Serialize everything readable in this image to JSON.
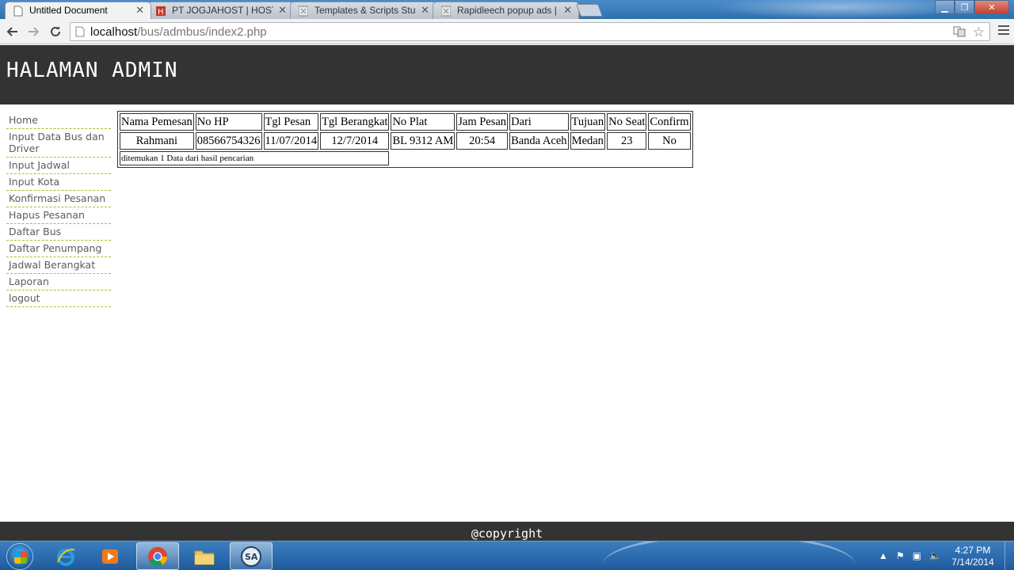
{
  "browser": {
    "tabs": [
      {
        "title": "Untitled Document",
        "active": true
      },
      {
        "title": "PT JOGJAHOST | HOSTING",
        "active": false
      },
      {
        "title": "Templates & Scripts Stuff",
        "active": false
      },
      {
        "title": "Rapidleech popup ads | Ka",
        "active": false
      }
    ],
    "url_host": "localhost",
    "url_path": "/bus/admbus/index2.php"
  },
  "header": {
    "title": "HALAMAN ADMIN"
  },
  "sidebar": {
    "items": [
      {
        "label": "Home"
      },
      {
        "label": "Input Data Bus dan Driver"
      },
      {
        "label": "Input Jadwal"
      },
      {
        "label": "Input Kota"
      },
      {
        "label": "Konfirmasi Pesanan"
      },
      {
        "label": "Hapus Pesanan"
      },
      {
        "label": "Daftar Bus"
      },
      {
        "label": "Daftar Penumpang"
      },
      {
        "label": "Jadwal Berangkat"
      },
      {
        "label": "Laporan"
      },
      {
        "label": "logout"
      }
    ]
  },
  "table": {
    "columns": [
      "Nama Pemesan",
      "No HP",
      "Tgl Pesan",
      "Tgl Berangkat",
      "No Plat",
      "Jam Pesan",
      "Dari",
      "Tujuan",
      "No Seat",
      "Confirm"
    ],
    "rows": [
      [
        "Rahmani",
        "08566754326",
        "11/07/2014",
        "12/7/2014",
        "BL 9312 AM",
        "20:54",
        "Banda Aceh",
        "Medan",
        "23",
        "No"
      ]
    ],
    "footer_text": "ditemukan 1 Data dari hasil pencarian"
  },
  "footer": {
    "text": "@copyright"
  },
  "taskbar": {
    "apps": [
      "internet-explorer",
      "media-player",
      "chrome",
      "file-explorer",
      "sa-app"
    ],
    "time": "4:27 PM",
    "date": "7/14/2014"
  }
}
